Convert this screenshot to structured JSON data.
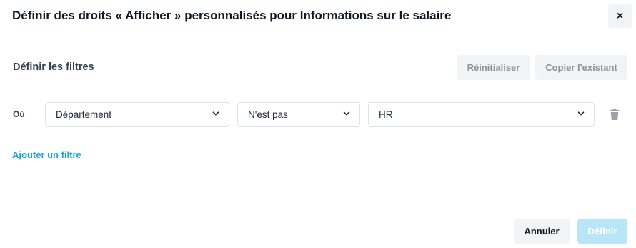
{
  "dialog": {
    "title": "Définir des droits « Afficher » personnalisés pour Informations sur le salaire",
    "close_label": "×"
  },
  "filters": {
    "section_title": "Définir les filtres",
    "reset_label": "Réinitialiser",
    "copy_label": "Copier l'existant",
    "rows": [
      {
        "where_label": "Où",
        "field": "Département",
        "operator": "N'est pas",
        "value": "HR"
      }
    ],
    "add_filter_label": "Ajouter un filtre"
  },
  "footer": {
    "cancel_label": "Annuler",
    "define_label": "Définir"
  },
  "icons": {
    "close": "close-icon",
    "chevron": "chevron-down-icon",
    "trash": "trash-icon"
  },
  "colors": {
    "accent": "#1aa3d6",
    "primary_disabled": "#b9e6f7",
    "light_button": "#f1f3f5"
  }
}
